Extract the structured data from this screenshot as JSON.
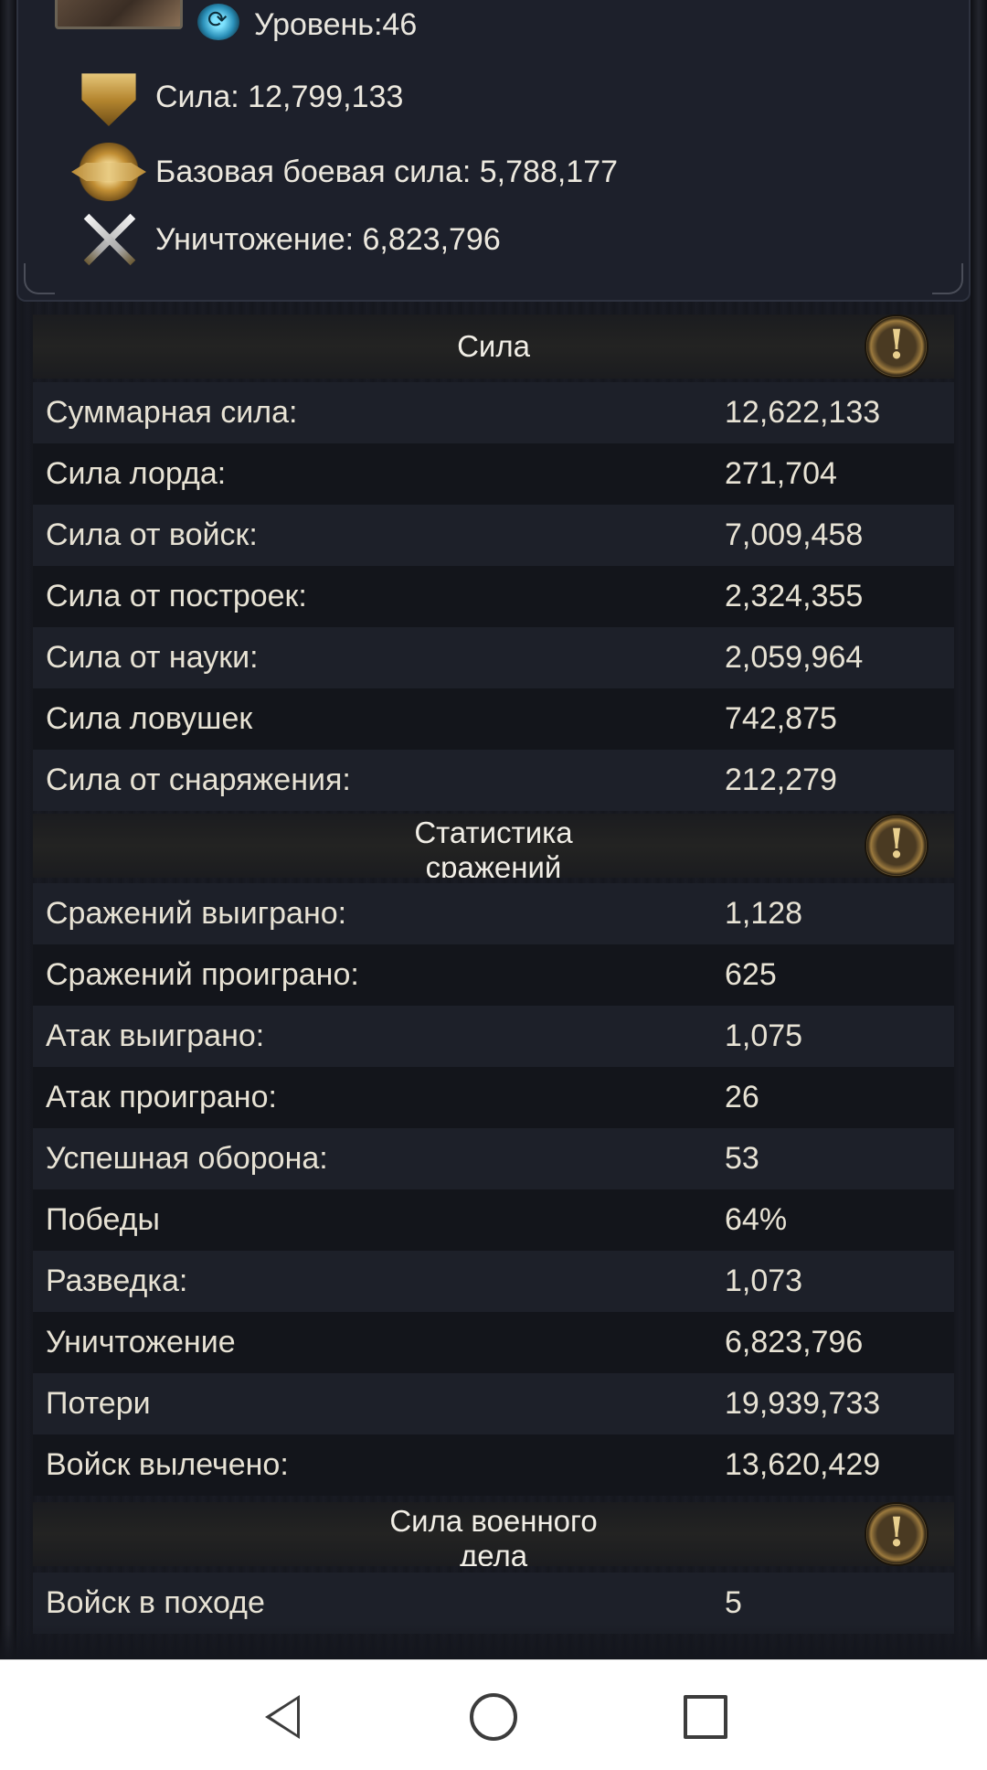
{
  "profile": {
    "level": "Уровень:46",
    "power": "Сила: 12,799,133",
    "base_power": "Базовая боевая сила: 5,788,177",
    "destruction": "Уничтожение: 6,823,796"
  },
  "sections": {
    "power": {
      "title": "Сила",
      "rows": [
        {
          "label": "Суммарная сила:",
          "value": "12,622,133"
        },
        {
          "label": "Сила лорда:",
          "value": "271,704"
        },
        {
          "label": "Сила от войск:",
          "value": "7,009,458"
        },
        {
          "label": "Сила от построек:",
          "value": "2,324,355"
        },
        {
          "label": "Сила от науки:",
          "value": "2,059,964"
        },
        {
          "label": "Сила ловушек",
          "value": "742,875"
        },
        {
          "label": "Сила от снаряжения:",
          "value": "212,279"
        }
      ]
    },
    "battle": {
      "title": "Статистика сражений",
      "rows": [
        {
          "label": "Сражений выиграно:",
          "value": "1,128"
        },
        {
          "label": "Сражений проиграно:",
          "value": "625"
        },
        {
          "label": "Атак выиграно:",
          "value": "1,075"
        },
        {
          "label": "Атак проиграно:",
          "value": "26"
        },
        {
          "label": "Успешная оборона:",
          "value": "53"
        },
        {
          "label": "Победы",
          "value": "64%"
        },
        {
          "label": "Разведка:",
          "value": "1,073"
        },
        {
          "label": "Уничтожение",
          "value": "6,823,796"
        },
        {
          "label": "Потери",
          "value": "19,939,733"
        },
        {
          "label": "Войск вылечено:",
          "value": "13,620,429"
        }
      ]
    },
    "military": {
      "title": "Сила военного дела",
      "rows": [
        {
          "label": "Войск в походе",
          "value": "5"
        }
      ]
    }
  },
  "icons": {
    "level": "refresh-icon",
    "power": "shield-emblem-icon",
    "base_power": "winged-emblem-icon",
    "destruction": "crossed-swords-icon",
    "info": "exclamation-icon"
  }
}
